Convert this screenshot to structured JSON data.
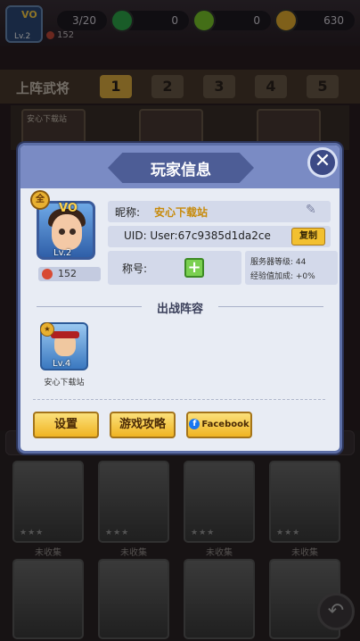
{
  "topbar": {
    "avatar_vip": "VO",
    "avatar_level": "Lv.2",
    "troops": "3/20",
    "stamina": "152",
    "resource_green": "0",
    "resource_lime": "0",
    "resource_gold": "630",
    "colors": {
      "green": "#2fa84a",
      "lime": "#7ac82a",
      "gold": "#e8b030"
    }
  },
  "lineup": {
    "title": "上阵武将",
    "tabs": [
      "1",
      "2",
      "3",
      "4",
      "5"
    ],
    "active_tab": "1",
    "deck_label": "安心下载站"
  },
  "modal": {
    "title": "玩家信息",
    "close_icon": "close-icon",
    "portrait": {
      "vip": "VO",
      "level": "Lv.2",
      "power": "152",
      "medal": "全"
    },
    "nickname_label": "昵称:",
    "nickname_value": "安心下载站",
    "uid_text": "UID: User:67c9385d1da2ce",
    "copy_label": "复制",
    "honor_label": "称号:",
    "server_level": "服务器等级: 44",
    "exp_bonus": "经验值加成: +0%",
    "lineup_title": "出战阵容",
    "hero": {
      "level": "Lv.4",
      "name": "安心下载站"
    },
    "buttons": {
      "settings": "设置",
      "guide": "游戏攻略",
      "facebook": "Facebook"
    }
  },
  "gallery": {
    "labels": [
      "未收集",
      "未收集",
      "未收集",
      "未收集"
    ],
    "stars": "★★★"
  },
  "accent": {
    "modal_head": "#7a8bc4",
    "button": "#f0b422"
  }
}
